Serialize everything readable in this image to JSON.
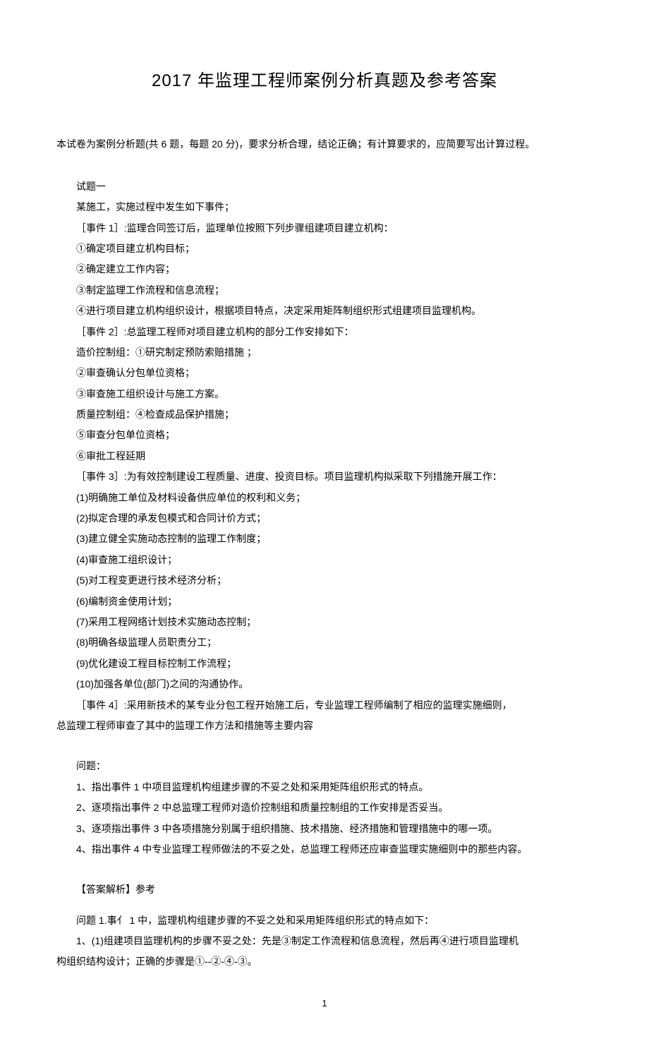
{
  "title": "2017 年监理工程师案例分析真题及参考答案",
  "intro": "本试卷为案例分析题(共 6 题，每题 20 分)，要求分析合理，结论正确；有计算要求的，应简要写出计算过程。",
  "section1": {
    "h": "试题一",
    "p1": "某施工，实施过程中发生如下事件；",
    "e1": "［事件 1］:监理合同签订后，监理单位按照下列步骤组建项目建立机构：",
    "e1_1": "①确定项目建立机构目标；",
    "e1_2": "②确定建立工作内容；",
    "e1_3": "③制定监理工作流程和信息流程；",
    "e1_4": "④进行项目建立机构组织设计，根据项目特点，决定采用矩阵制组织形式组建项目监理机构。",
    "e2": "［事件 2］:总监理工程师对项目建立机构的部分工作安排如下：",
    "e2_1": "造价控制组：①研究制定预防索赔措施 ；",
    "e2_2": "②审查确认分包单位资格；",
    "e2_3": "③审查施工组织设计与施工方案。",
    "e2_4": "质量控制组：④检查成品保护措施；",
    "e2_5": "⑤审查分包单位资格；",
    "e2_6": "⑥审批工程延期",
    "e3": "［事件 3］:为有效控制建设工程质量、进度、投资目标。项目监理机构拟采取下列措施开展工作：",
    "e3_1": "(1)明确施工单位及材料设备供应单位的权利和义务；",
    "e3_2": "(2)拟定合理的承发包模式和合同计价方式；",
    "e3_3": "(3)建立健全实施动态控制的监理工作制度；",
    "e3_4": "(4)审查施工组织设计；",
    "e3_5": "(5)对工程变更进行技术经济分析；",
    "e3_6": "(6)编制资金使用计划；",
    "e3_7": "(7)采用工程网络计划技术实施动态控制；",
    "e3_8": "(8)明确各级监理人员职责分工；",
    "e3_9": "(9)优化建设工程目标控制工作流程；",
    "e3_10": "(10)加强各单位(部门)之间的沟通协作。",
    "e4": "［事件 4］:采用新技术的某专业分包工程开始施工后，专业监理工程师编制了相应的监理实施细则，",
    "e4b": "总监理工程师审查了其中的监理工作方法和措施等主要内容"
  },
  "questions": {
    "h": "问题：",
    "q1": "1、指出事件 1 中项目监理机构组建步骤的不妥之处和采用矩阵组织形式的特点。",
    "q2": "2、逐项指出事件 2 中总监理工程师对造价控制组和质量控制组的工作安排是否妥当。",
    "q3": "3、逐项指出事件 3 中各项措施分别属于组织措施、技术措施、经济措施和管理措施中的哪一项。",
    "q4": "4、指出事件 4 中专业监理工程师做法的不妥之处，总监理工程师还应审查监理实施细则中的那些内容。"
  },
  "answers": {
    "h": "【答案解析】参考",
    "a1": "问题 1.事亻 1 中，监理机构组建步骤的不妥之处和采用矩阵组织形式的特点如下：",
    "a1_1": "1、(1)组建项目监理机构的步骤不妥之处：先是③制定工作流程和信息流程，然后再④进行项目监理机",
    "a1_2": "构组织结构设计；正确的步骤是①--②-④-③。"
  },
  "pagenum": "1"
}
